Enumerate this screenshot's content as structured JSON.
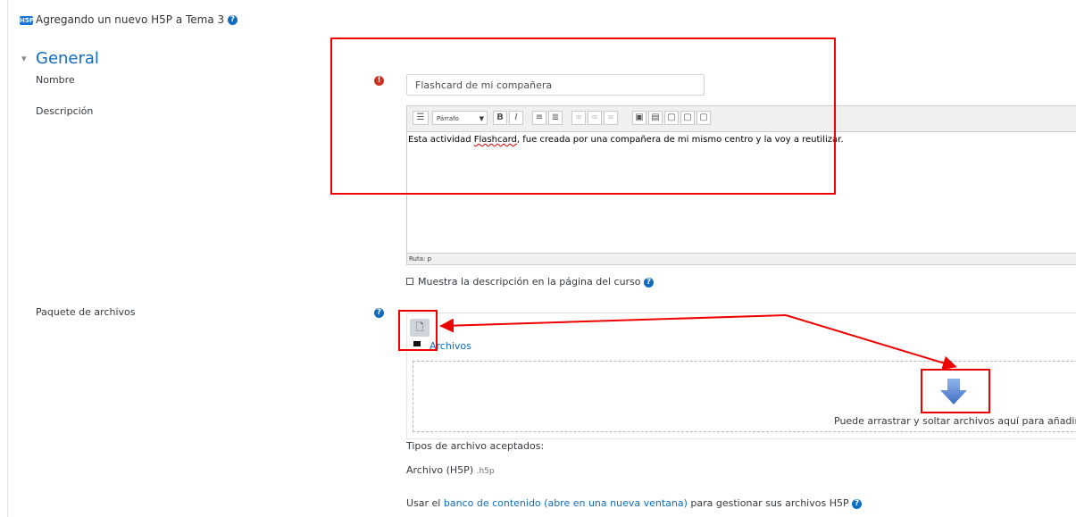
{
  "header": {
    "badge": "H5P",
    "title": "Agregando un nuevo H5P a Tema 3"
  },
  "section": {
    "toggle": "▾",
    "title": "General"
  },
  "fields": {
    "nombre_label": "Nombre",
    "nombre_value": "Flashcard de mi compañera",
    "descripcion_label": "Descripción",
    "paquete_label": "Paquete de archivos"
  },
  "editor": {
    "format_select": "Párrafo",
    "text_before": "Esta actividad ",
    "text_misspelled": "Flashcard",
    "text_after": ", fue creada por una compañera de mi mismo centro y la voy a reutilizar.",
    "path": "Ruta: p"
  },
  "show_description": {
    "label": "Muestra la descripción en la página del curso",
    "checked": false
  },
  "filepicker": {
    "folder_label": "Archivos",
    "drop_text": "Puede arrastrar y soltar archivos aquí para añadirlos"
  },
  "accepted": {
    "title": "Tipos de archivo aceptados:",
    "type_name": "Archivo (H5P)",
    "type_ext": ".h5p"
  },
  "content_bank": {
    "prefix": "Usar el ",
    "link": "banco de contenido (abre en una nueva ventana)",
    "suffix": " para gestionar sus archivos H5P"
  },
  "colors": {
    "accent": "#0f6cbf",
    "error": "#ca3120",
    "annotation": "#ee0000"
  }
}
